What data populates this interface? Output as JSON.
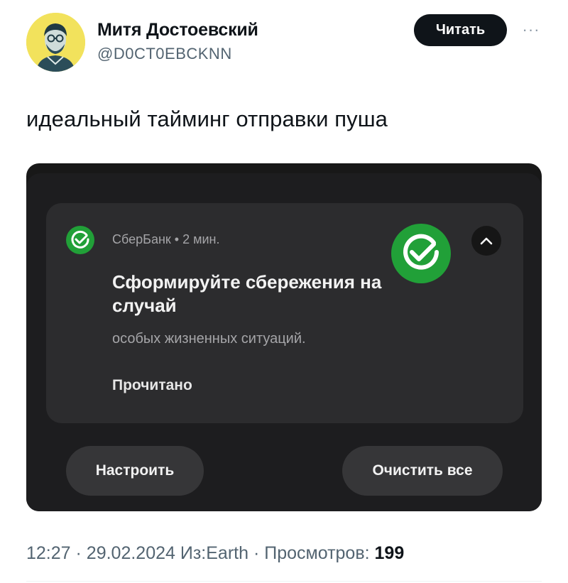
{
  "tweet": {
    "author": {
      "display_name": "Митя Достоевский",
      "handle": "@D0CT0EBCKNN"
    },
    "follow_label": "Читать",
    "more_icon": "more-horizontal-icon",
    "text": "идеальный тайминг отправки пуша",
    "meta": {
      "time": "12:27",
      "date": "29.02.2024",
      "source": "Из:Earth",
      "views_label": "Просмотров:",
      "views_count": "199"
    }
  },
  "screenshot": {
    "notification": {
      "app_name": "СберБанк",
      "time_ago": "2 мин.",
      "title": "Сформируйте сбережения на случай",
      "body": "особых жизненных ситуаций.",
      "action": "Прочитано",
      "app_icon": "sber-check-icon",
      "collapse_icon": "chevron-up-icon"
    },
    "buttons": {
      "configure": "Настроить",
      "clear_all": "Очистить все"
    }
  },
  "colors": {
    "sber_green": "#21a038",
    "follow_bg": "#0f1419",
    "muted_text": "#536471"
  }
}
